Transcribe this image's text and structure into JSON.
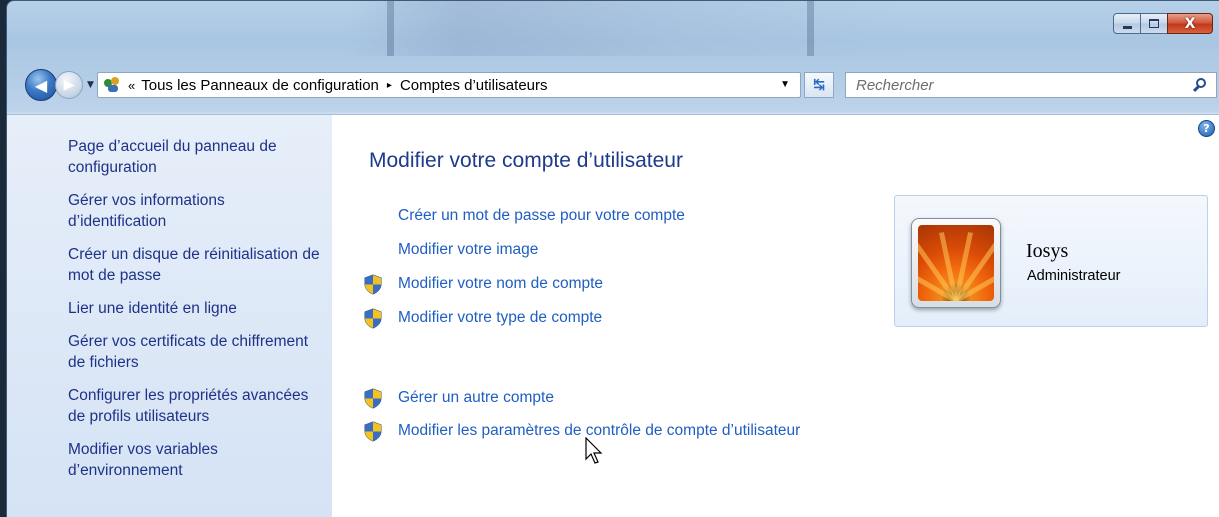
{
  "window": {
    "caption_buttons": {
      "minimize_icon": "minimize-icon",
      "maximize_icon": "maximize-icon",
      "close_label": "X"
    }
  },
  "navigation": {
    "back_icon": "arrow-left-icon",
    "forward_icon": "arrow-right-icon",
    "history_dropdown_icon": "chevron-down-icon",
    "breadcrumb": {
      "overflow": "«",
      "items": [
        "Tous les Panneaux de configuration",
        "Comptes d’utilisateurs"
      ],
      "separator": "▸"
    },
    "refresh_icon": "refresh-icon",
    "search": {
      "placeholder": "Rechercher",
      "value": ""
    }
  },
  "sidebar": {
    "items": [
      {
        "label": "Page d’accueil du panneau de configuration"
      },
      {
        "label": "Gérer vos informations d’identification"
      },
      {
        "label": "Créer un disque de réinitialisation de mot de passe"
      },
      {
        "label": "Lier une identité en ligne"
      },
      {
        "label": "Gérer vos certificats de chiffrement de fichiers"
      },
      {
        "label": "Configurer les propriétés avancées de profils utilisateurs"
      },
      {
        "label": "Modifier vos variables d’environnement"
      }
    ]
  },
  "main": {
    "title": "Modifier votre compte d’utilisateur",
    "help_label": "?",
    "tasks": [
      {
        "label": "Créer un mot de passe pour votre compte",
        "shield": false
      },
      {
        "label": "Modifier votre image",
        "shield": false
      },
      {
        "label": "Modifier votre nom de compte",
        "shield": true
      },
      {
        "label": "Modifier votre type de compte",
        "shield": true
      },
      {
        "label": "Gérer un autre compte",
        "shield": true
      },
      {
        "label": "Modifier les paramètres de contrôle de compte d’utilisateur",
        "shield": true
      }
    ],
    "user": {
      "name": "Iosys",
      "role": "Administrateur",
      "avatar_icon": "flower-avatar"
    }
  },
  "colors": {
    "link": "#1f5ec2",
    "sidebar_link": "#1e3287",
    "title": "#1e3a8a",
    "sidebar_bg": "#dce8f7",
    "close_button": "#c7401f"
  }
}
